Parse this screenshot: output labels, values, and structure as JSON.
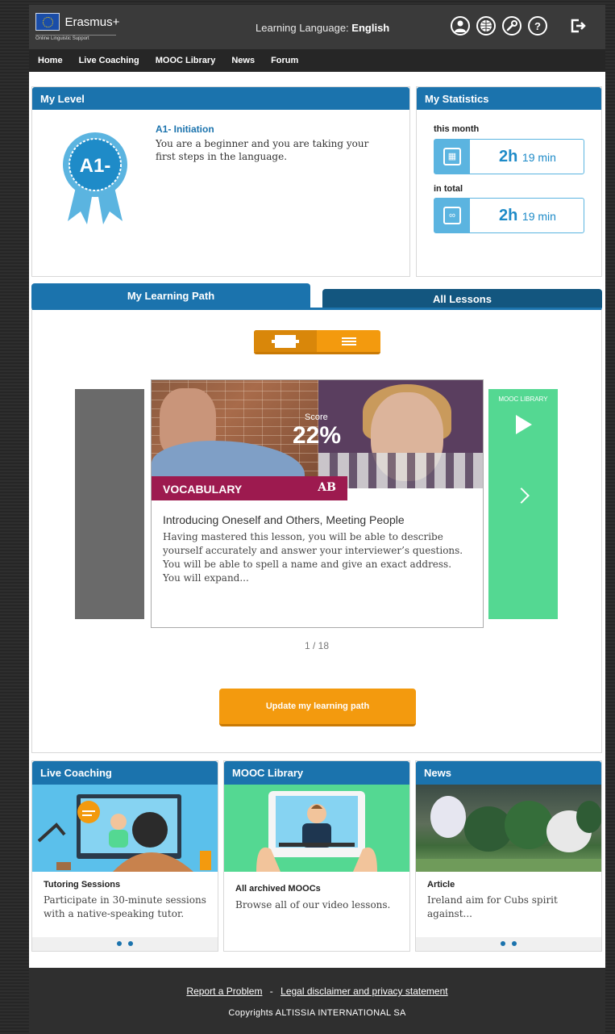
{
  "header": {
    "logo_text": "Erasmus+",
    "logo_sub": "Online Linguistic Support",
    "learning_language_label": "Learning Language:",
    "learning_language_value": "English",
    "icons": [
      "user-icon",
      "globe-icon",
      "wrench-icon",
      "help-icon",
      "logout-icon"
    ],
    "help_glyph": "?"
  },
  "nav": [
    "Home",
    "Live Coaching",
    "MOOC Library",
    "News",
    "Forum"
  ],
  "my_level": {
    "title": "My Level",
    "badge": "A1-",
    "level_name": "A1- Initiation",
    "description": "You are a beginner and you are taking your first steps in the language."
  },
  "stats": {
    "title": "My Statistics",
    "month_label": "this month",
    "month_hours": "2h",
    "month_minutes": "19 min",
    "total_label": "in total",
    "total_hours": "2h",
    "total_minutes": "19 min",
    "infinity": "∞"
  },
  "tabs": {
    "path": "My Learning Path",
    "all": "All Lessons"
  },
  "carousel": {
    "score_label": "Score",
    "score_value": "22%",
    "category": "VOCABULARY",
    "category_icon": "AB",
    "lesson_title": "Introducing Oneself and Others, Meeting People",
    "lesson_desc": "Having mastered this lesson, you will be able to describe yourself accurately and answer your interviewer’s questions. You will be able to spell a name and give an exact address. You will expand...",
    "next_label": "MOOC LIBRARY",
    "pager": "1 / 18",
    "update_button": "Update my learning path"
  },
  "cards": {
    "coaching": {
      "title": "Live Coaching",
      "item_title": "Tutoring Sessions",
      "item_desc": "Participate in 30-minute sessions with a native-speaking tutor."
    },
    "mooc": {
      "title": "MOOC Library",
      "item_title": "All archived MOOCs",
      "item_desc": "Browse all of our video lessons."
    },
    "news": {
      "title": "News",
      "item_title": "Article",
      "item_desc": "Ireland aim for Cubs spirit against..."
    }
  },
  "footer": {
    "report": "Report a Problem",
    "separator": "-",
    "legal": "Legal disclaimer and privacy statement",
    "copyright": "Copyrights ALTISSIA INTERNATIONAL SA"
  },
  "colors": {
    "primary_blue": "#1b73ad",
    "orange": "#f39a0e",
    "green": "#54d892",
    "vocab_magenta": "#9d1a4f",
    "light_blue": "#5bb4e0"
  }
}
